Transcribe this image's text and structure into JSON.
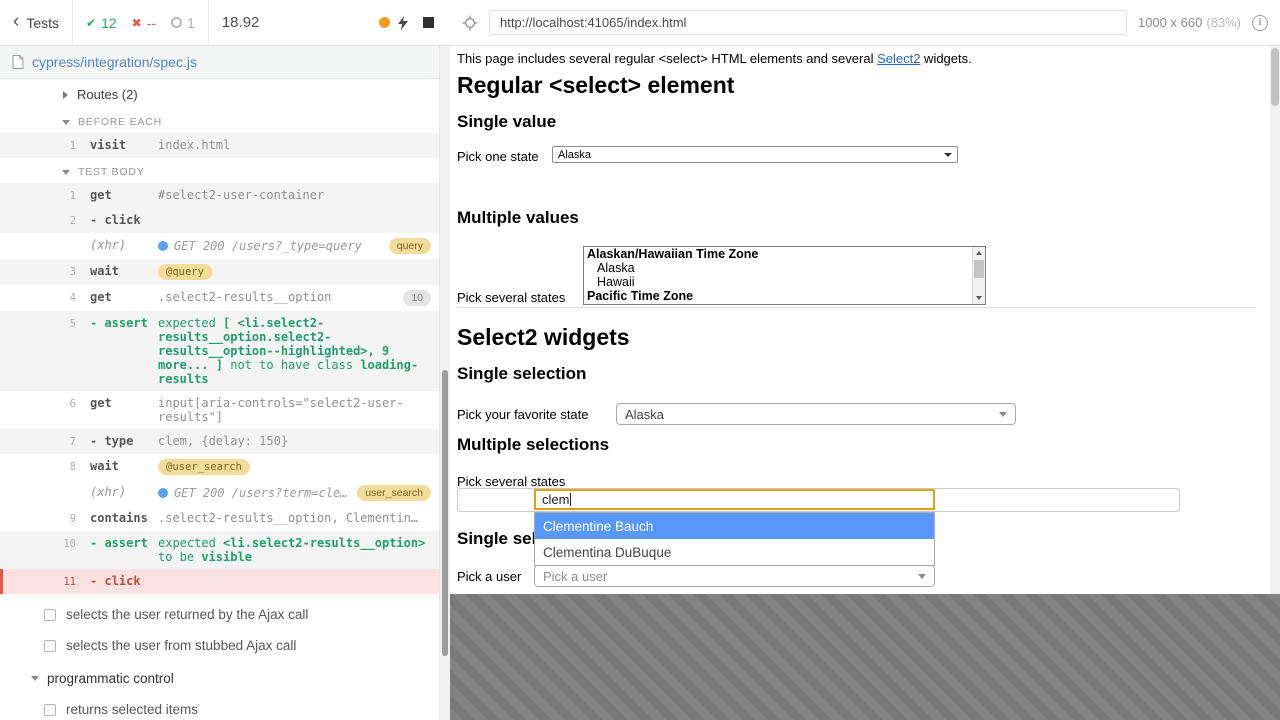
{
  "icons": {
    "back": "‹",
    "passed": "✔",
    "failed": "✖",
    "info": "i"
  },
  "topbar": {
    "back_label": "Tests",
    "stats": {
      "passed": "12",
      "failed": "--",
      "pending": "1"
    },
    "duration": "18.92",
    "url": "http://localhost:41065/index.html",
    "viewport_size": "1000 x 660",
    "viewport_zoom": "(83%)"
  },
  "sidebar": {
    "spec_path": "cypress/integration/spec.js",
    "suite_label": "Routes (2)",
    "sections": [
      {
        "title": "BEFORE EACH",
        "rows": [
          {
            "num": "1",
            "cmd": "visit",
            "detail": "index.html",
            "alt": true
          }
        ]
      },
      {
        "title": "TEST BODY",
        "rows": [
          {
            "num": "1",
            "cmd": "get",
            "detail": "#select2-user-container",
            "alt": true
          },
          {
            "num": "2",
            "cmd": "click",
            "dash": true,
            "alt": true
          },
          {
            "kind": "xhr",
            "cmd": "(xhr)",
            "detail": "GET 200 /users?_type=query",
            "badge": {
              "text": "query",
              "style": "alias"
            }
          },
          {
            "num": "3",
            "cmd": "wait",
            "kind": "wait",
            "alias": "@query",
            "alt": true
          },
          {
            "num": "4",
            "cmd": "get",
            "detail": ".select2-results__option",
            "badge": {
              "text": "10",
              "style": "count"
            }
          },
          {
            "num": "5",
            "cmd": "assert",
            "dash": true,
            "kind": "assert",
            "alt": true,
            "segments": [
              {
                "t": "expected ",
                "b": false
              },
              {
                "t": "[ <li.select2-results__option.select2-results__option--highlighted>, 9 more... ]",
                "b": true
              },
              {
                "t": " not to have class ",
                "b": false
              },
              {
                "t": "loading-results",
                "b": true
              }
            ]
          },
          {
            "num": "6",
            "cmd": "get",
            "detail": "input[aria-controls=\"select2-user-results\"]"
          },
          {
            "num": "7",
            "cmd": "type",
            "dash": true,
            "detail": "clem, {delay: 150}",
            "alt": true
          },
          {
            "num": "8",
            "cmd": "wait",
            "kind": "wait",
            "alias": "@user_search"
          },
          {
            "kind": "xhr",
            "cmd": "(xhr)",
            "detail": "GET 200 /users?term=cle…",
            "badge": {
              "text": "user_search",
              "style": "alias"
            }
          },
          {
            "num": "9",
            "cmd": "contains",
            "detail": ".select2-results__option, Clementin…"
          },
          {
            "num": "10",
            "cmd": "assert",
            "dash": true,
            "kind": "assert",
            "alt": true,
            "segments": [
              {
                "t": "expected ",
                "b": false
              },
              {
                "t": "<li.select2-results__option>",
                "b": true
              },
              {
                "t": " to be ",
                "b": false
              },
              {
                "t": "visible",
                "b": true
              }
            ]
          },
          {
            "num": "11",
            "cmd": "click",
            "dash": true,
            "kind": "active"
          }
        ]
      }
    ],
    "tests": [
      "selects the user returned by the Ajax call",
      "selects the user from stubbed Ajax call"
    ],
    "suite2_label": "programmatic control",
    "tests2": [
      "returns selected items"
    ]
  },
  "app": {
    "intro_pre": "This page includes several regular <select> HTML elements and several ",
    "intro_link": "Select2",
    "intro_post": " widgets.",
    "h1_regular": "Regular <select> element",
    "h2_single_value": "Single value",
    "pick_one_label": "Pick one state",
    "pick_one_value": "Alaska",
    "h2_multiple_values": "Multiple values",
    "pick_several_label": "Pick several states",
    "listbox_groups": [
      {
        "label": "Alaskan/Hawaiian Time Zone",
        "options": [
          "Alaska",
          "Hawaii"
        ]
      },
      {
        "label": "Pacific Time Zone",
        "options": []
      }
    ],
    "h1_select2": "Select2 widgets",
    "h2_single_selection": "Single selection",
    "favorite_label": "Pick your favorite state",
    "favorite_value": "Alaska",
    "h2_multiple_selections": "Multiple selections",
    "several2_label": "Pick several states",
    "search_value": "clem",
    "dropdown_options": [
      {
        "label": "Clementine Bauch",
        "highlighted": true
      },
      {
        "label": "Clementina DuBuque",
        "highlighted": false
      }
    ],
    "h2_single_selection_2": "Single selection",
    "pick_user_label": "Pick a user",
    "pick_user_placeholder": "Pick a user"
  }
}
